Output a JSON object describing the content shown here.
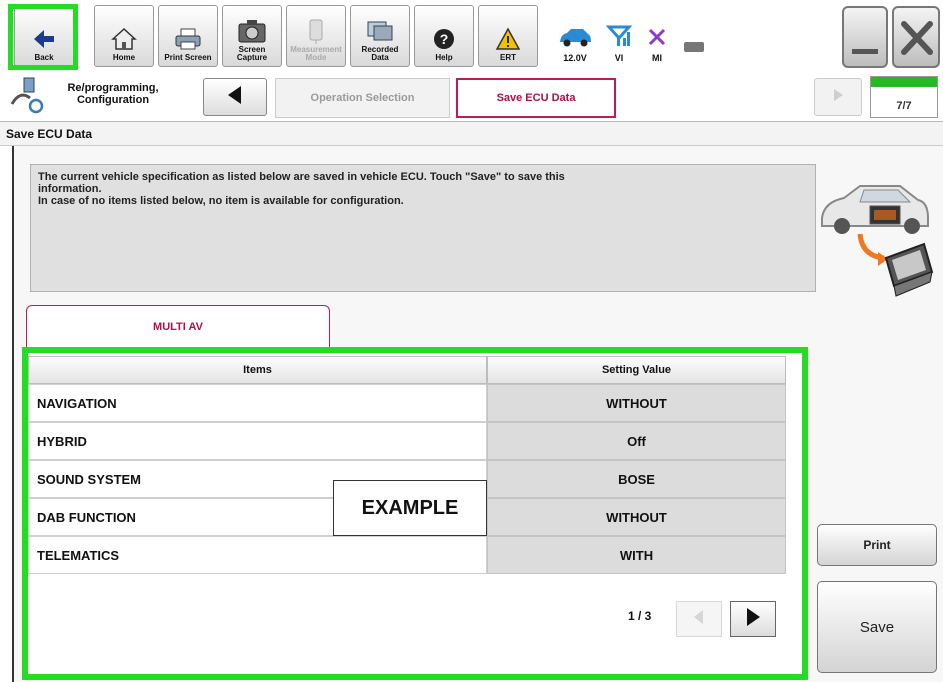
{
  "toolbar": {
    "buttons": [
      {
        "label": "Back",
        "icon": "back-arrow-icon",
        "enabled": true
      },
      {
        "label": "Home",
        "icon": "home-icon",
        "enabled": true
      },
      {
        "label": "Print Screen",
        "icon": "printer-icon",
        "enabled": true
      },
      {
        "label": "Screen\nCapture",
        "icon": "camera-icon",
        "enabled": true
      },
      {
        "label": "Measurement\nMode",
        "icon": "meter-icon",
        "enabled": false
      },
      {
        "label": "Recorded\nData",
        "icon": "recorded-data-icon",
        "enabled": true
      },
      {
        "label": "Help",
        "icon": "help-icon",
        "enabled": true
      },
      {
        "label": "ERT",
        "icon": "warning-icon",
        "enabled": true
      }
    ],
    "status": {
      "battery_label": "12.0V",
      "vi_label": "VI",
      "mi_label": "MI"
    },
    "highlight_color": "#22dd22"
  },
  "breadcrumb": {
    "section": "Re/programming,\nConfiguration",
    "tabs": [
      {
        "label": "Operation Selection",
        "active": false
      },
      {
        "label": "Save ECU Data",
        "active": true
      }
    ],
    "step": "7/7",
    "step_progress": 1.0
  },
  "page_title": "Save ECU Data",
  "info": {
    "lines": [
      "The current vehicle specification as listed below are saved in vehicle ECU. Touch \"Save\" to save this",
      "information.",
      "In case of no items listed below, no item is available for configuration."
    ]
  },
  "ecu_tab": "MULTI AV",
  "table": {
    "headers": [
      "Items",
      "Setting Value"
    ],
    "rows": [
      {
        "item": "NAVIGATION",
        "value": "WITHOUT"
      },
      {
        "item": "HYBRID",
        "value": "Off"
      },
      {
        "item": "SOUND SYSTEM",
        "value": "BOSE"
      },
      {
        "item": "DAB FUNCTION",
        "value": "WITHOUT"
      },
      {
        "item": "TELEMATICS",
        "value": "WITH"
      }
    ]
  },
  "pager": {
    "text": "1 / 3"
  },
  "example_label": "EXAMPLE",
  "actions": {
    "print_label": "Print",
    "save_label": "Save"
  },
  "colors": {
    "accent_pink": "#c01858",
    "highlight_green": "#22dd22"
  }
}
